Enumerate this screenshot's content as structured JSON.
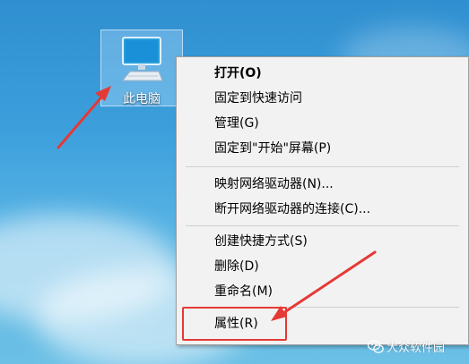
{
  "desktop": {
    "icon_label": "此电脑",
    "icon_name": "this-pc-icon"
  },
  "context_menu": {
    "items": [
      {
        "label": "打开(O)",
        "bold": true
      },
      {
        "label": "固定到快速访问"
      },
      {
        "label": "管理(G)"
      },
      {
        "label": "固定到\"开始\"屏幕(P)"
      },
      {
        "label": "映射网络驱动器(N)..."
      },
      {
        "label": "断开网络驱动器的连接(C)..."
      },
      {
        "label": "创建快捷方式(S)"
      },
      {
        "label": "删除(D)"
      },
      {
        "label": "重命名(M)"
      },
      {
        "label": "属性(R)"
      }
    ],
    "highlighted_item": "属性(R)"
  },
  "annotations": {
    "arrow_color": "#e53935",
    "highlight_color": "#e53935"
  },
  "watermark": {
    "text": "大众软件园"
  }
}
